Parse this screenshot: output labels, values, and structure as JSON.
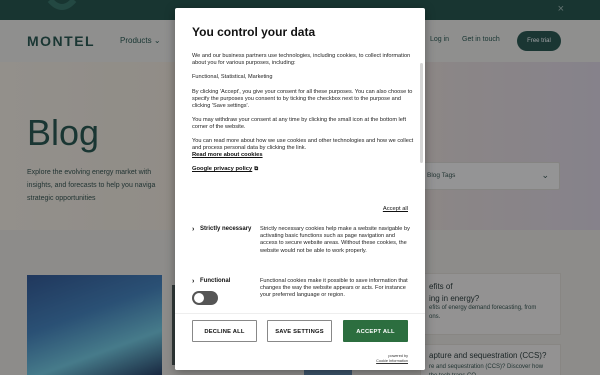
{
  "background": {
    "brand": "MONTEL",
    "nav": {
      "products_label": "Products",
      "chevron": "⌄",
      "login_label": "Log in",
      "contact_label": "Get in touch",
      "trial_label": "Free trial"
    },
    "close_glyph": "×",
    "hero": {
      "title": "Blog",
      "description": "Explore the evolving energy market with insights, and forecasts to help you naviga strategic opportunities",
      "tags_label": "Blog Tags",
      "tags_chevron": "⌄"
    },
    "cards": [
      {
        "title": "efits of\ning in energy?",
        "snippet": "efits of energy demand forecasting, from\nons."
      },
      {
        "title": "apture and sequestration (CCS)?",
        "snippet": "re and sequestration (CCS)? Discover how\nthe tech traps CO..."
      }
    ]
  },
  "consent": {
    "title": "You control your data",
    "intro": "We and our business partners use technologies, including cookies, to collect information about you for various purposes, including:",
    "purposes": "Functional, Statistical, Marketing",
    "accept_info": "By clicking 'Accept', you give your consent for all these purposes. You can also choose to specify the purposes you consent to by ticking the checkbox next to the purpose and clicking 'Save settings'.",
    "withdraw_info": "You may withdraw your consent at any time by clicking the small icon at the bottom left corner of the website.",
    "read_more_info": "You can read more about how we use cookies and other technologies and how we collect and process personal data by clicking the link.",
    "read_more_link": "Read more about cookies",
    "google_link": "Google privacy policy",
    "external_icon": "⧉",
    "accept_all_link": "Accept all",
    "categories": [
      {
        "chevron": "›",
        "name": "Strictly necessary",
        "description": "Strictly necessary cookies help make a website navigable by activating basic functions such as page navigation and access to secure website areas. Without these cookies, the website would not be able to work properly."
      },
      {
        "chevron": "›",
        "name": "Functional",
        "description": "Functional cookies make it possible to save information that changes the way the website appears or acts. For instance your preferred language or region."
      }
    ],
    "functional_toggle_on": false,
    "buttons": {
      "decline": "DECLINE ALL",
      "save": "SAVE SETTINGS",
      "accept": "ACCEPT ALL"
    },
    "powered_by": "powered by",
    "powered_by_brand": "Cookie Information",
    "accent_color": "#2c6e3f"
  }
}
